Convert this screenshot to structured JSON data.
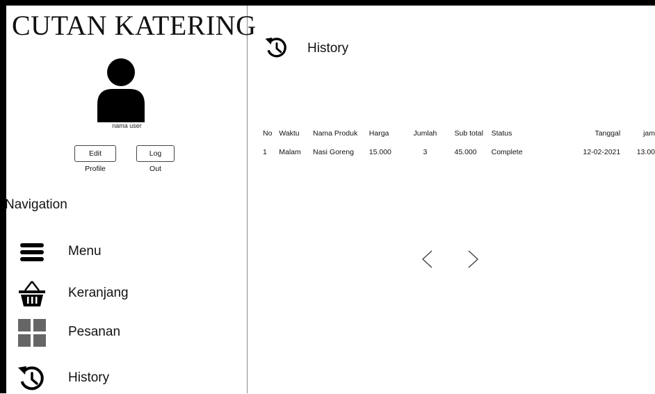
{
  "app": {
    "brand": "CUTAN KATERING"
  },
  "profile": {
    "username": "nama user",
    "edit_label": "Edit Profile",
    "logout_label": "Log Out"
  },
  "navigation": {
    "heading": "Navigation",
    "items": [
      {
        "label": "Menu",
        "icon": "menu-icon"
      },
      {
        "label": "Keranjang",
        "icon": "basket-icon"
      },
      {
        "label": "Pesanan",
        "icon": "grid-icon"
      },
      {
        "label": "History",
        "icon": "history-icon"
      }
    ]
  },
  "page": {
    "title": "History",
    "icon": "history-icon"
  },
  "table": {
    "headers": [
      "No",
      "Waktu",
      "Nama Produk",
      "Harga",
      "Jumlah",
      "Sub total",
      "Status",
      "Tanggal",
      "jam"
    ],
    "rows": [
      [
        "1",
        "Malam",
        "Nasi Goreng",
        "15.000",
        "3",
        "45.000",
        "Complete",
        "12-02-2021",
        "13.00"
      ]
    ]
  },
  "pagination": {
    "prev_icon": "chevron-left-icon",
    "next_icon": "chevron-right-icon"
  }
}
